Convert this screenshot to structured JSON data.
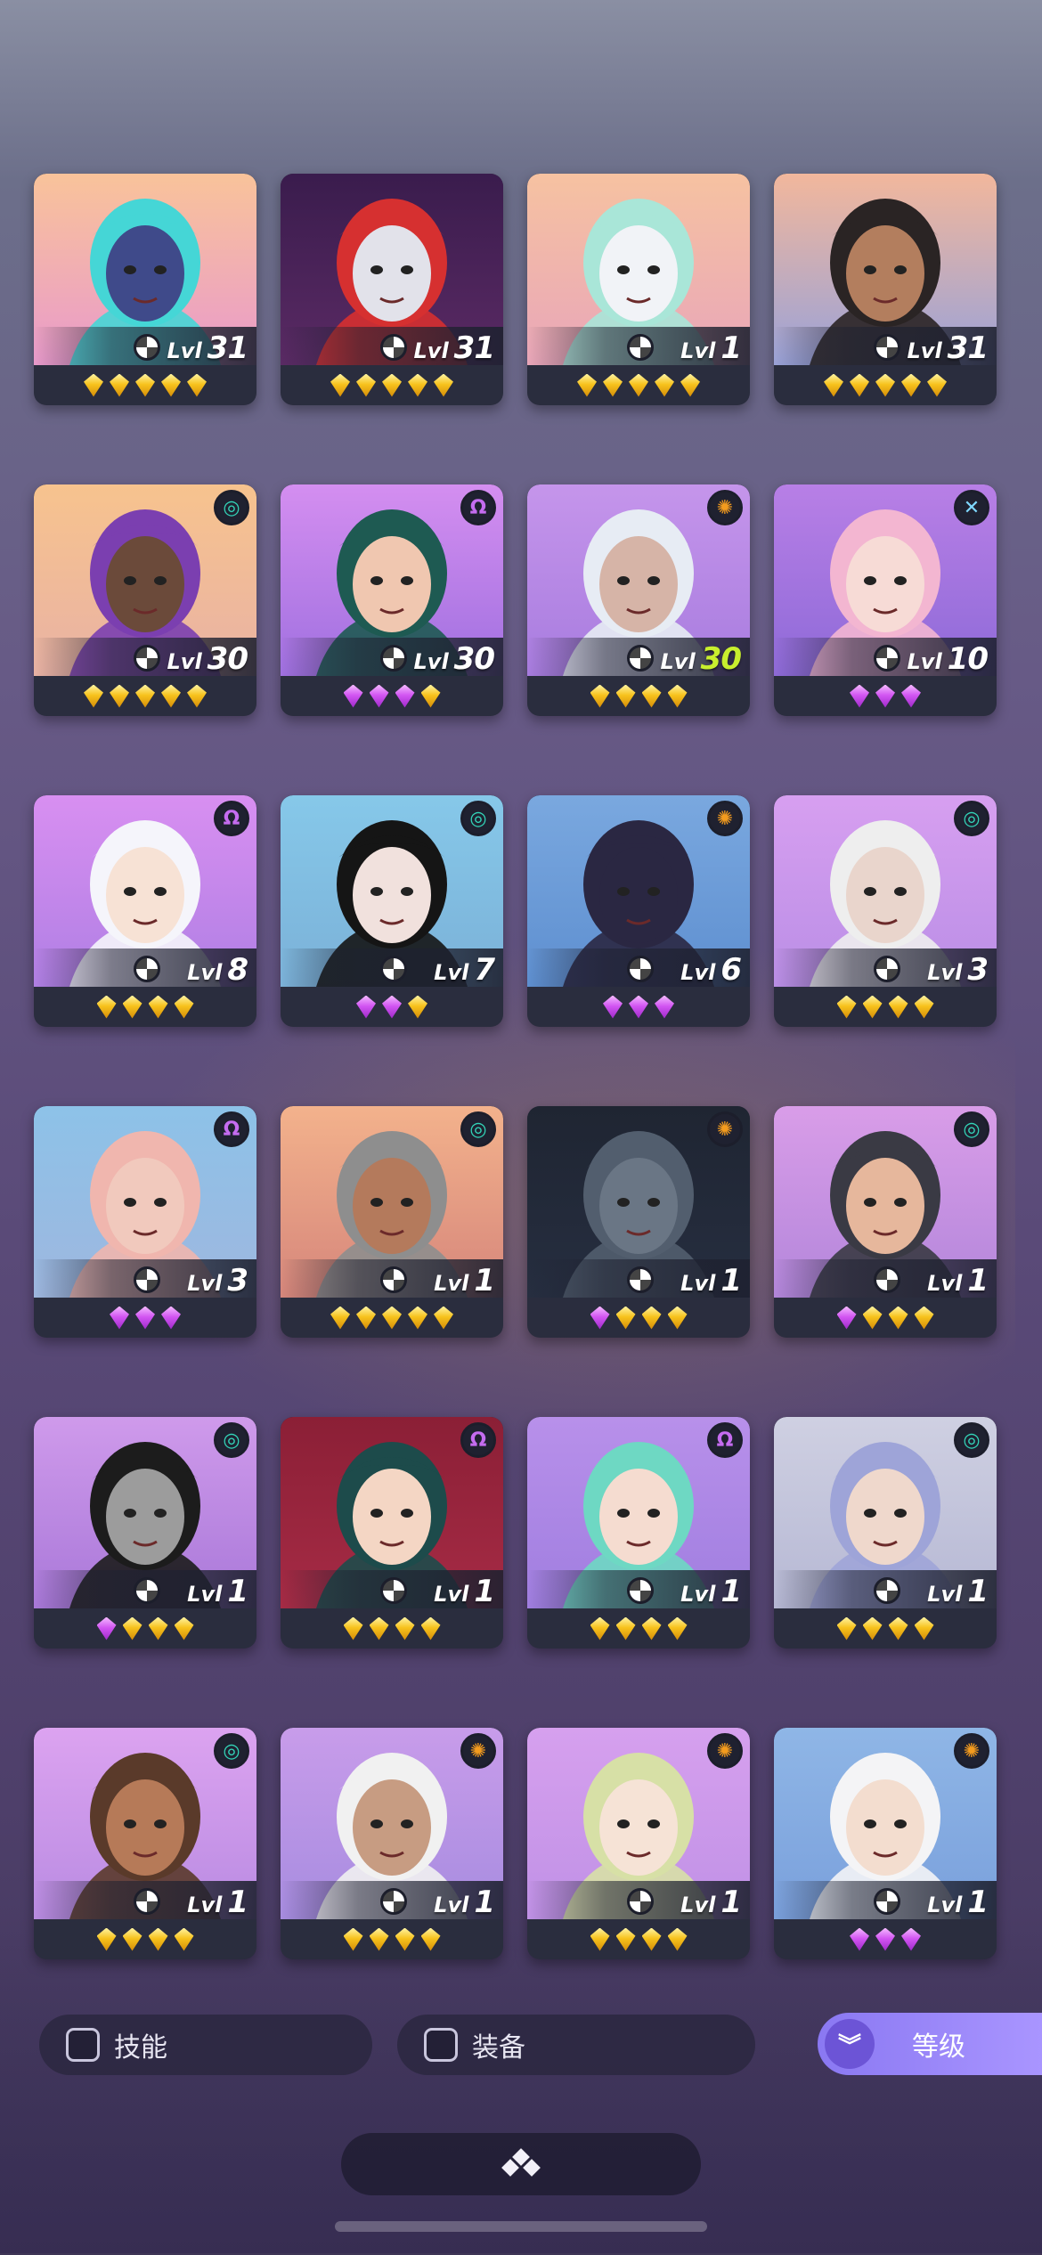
{
  "heroes": [
    {
      "level": "31",
      "stars": [
        "gold",
        "gold",
        "gold",
        "gold",
        "gold"
      ],
      "badge": null,
      "colors": [
        "#f9c39a",
        "#e99acb"
      ],
      "skin": "#3f4a8a",
      "hair": "#45d6d6"
    },
    {
      "level": "31",
      "stars": [
        "gold",
        "gold",
        "gold",
        "gold",
        "gold"
      ],
      "badge": null,
      "colors": [
        "#3a1c4d",
        "#5a2a64"
      ],
      "skin": "#e2e2ea",
      "hair": "#d63030"
    },
    {
      "level": "1",
      "stars": [
        "gold",
        "gold",
        "gold",
        "gold",
        "gold"
      ],
      "badge": null,
      "colors": [
        "#f6c2a1",
        "#e9a6b9"
      ],
      "skin": "#f1f3f7",
      "hair": "#a9e6d8"
    },
    {
      "level": "31",
      "stars": [
        "gold",
        "gold",
        "gold",
        "gold",
        "gold"
      ],
      "badge": null,
      "colors": [
        "#f2b79c",
        "#9aa2d8"
      ],
      "skin": "#b37e5e",
      "hair": "#2a2424"
    },
    {
      "level": "30",
      "stars": [
        "gold",
        "gold",
        "gold",
        "gold",
        "gold"
      ],
      "badge": "teal",
      "colors": [
        "#f7c38e",
        "#e9b2a4"
      ],
      "skin": "#6b4a3a",
      "hair": "#7b3fb0"
    },
    {
      "level": "30",
      "stars": [
        "purple",
        "purple",
        "purple",
        "gold"
      ],
      "badge": "purple",
      "colors": [
        "#d48ef0",
        "#a070e0"
      ],
      "skin": "#f0c7b0",
      "hair": "#1e5a52"
    },
    {
      "level": "30",
      "stars": [
        "gold",
        "gold",
        "gold",
        "gold"
      ],
      "badge": "orange",
      "colors": [
        "#c595eb",
        "#a87cdf"
      ],
      "skin": "#d6b4a7",
      "hair": "#e7ecf4",
      "green": true
    },
    {
      "level": "10",
      "stars": [
        "purple",
        "purple",
        "purple"
      ],
      "badge": "blue",
      "colors": [
        "#b87fe6",
        "#8e6ad8"
      ],
      "skin": "#f7dbd6",
      "hair": "#f3b6d1"
    },
    {
      "level": "8",
      "stars": [
        "gold",
        "gold",
        "gold",
        "gold"
      ],
      "badge": "purple",
      "colors": [
        "#d88ff1",
        "#b07fe4"
      ],
      "skin": "#f7e2d5",
      "hair": "#f5f5fb"
    },
    {
      "level": "7",
      "stars": [
        "purple",
        "purple",
        "gold"
      ],
      "badge": "teal",
      "colors": [
        "#86c8e9",
        "#7bb1d8"
      ],
      "skin": "#f1e1dd",
      "hair": "#151515"
    },
    {
      "level": "6",
      "stars": [
        "purple",
        "purple",
        "purple"
      ],
      "badge": "orange",
      "colors": [
        "#7aa8df",
        "#5e8fd0"
      ],
      "skin": "#2a2742",
      "hair": "#2a2742"
    },
    {
      "level": "3",
      "stars": [
        "gold",
        "gold",
        "gold",
        "gold"
      ],
      "badge": "teal",
      "colors": [
        "#d79ff0",
        "#ba8ee6"
      ],
      "skin": "#e9d5cc",
      "hair": "#eee"
    },
    {
      "level": "3",
      "stars": [
        "purple",
        "purple",
        "purple"
      ],
      "badge": "purple",
      "colors": [
        "#8dc2e8",
        "#9eb7df"
      ],
      "skin": "#f1c9bd",
      "hair": "#f0b6ae"
    },
    {
      "level": "1",
      "stars": [
        "gold",
        "gold",
        "gold",
        "gold",
        "gold"
      ],
      "badge": "teal",
      "colors": [
        "#f3b28c",
        "#d6867b"
      ],
      "skin": "#b47a5c",
      "hair": "#8e8e8e"
    },
    {
      "level": "1",
      "stars": [
        "purple",
        "gold",
        "gold",
        "gold"
      ],
      "badge": "orange",
      "colors": [
        "#1f2532",
        "#262e40"
      ],
      "skin": "#6a7685",
      "hair": "#525e6e"
    },
    {
      "level": "1",
      "stars": [
        "purple",
        "gold",
        "gold",
        "gold"
      ],
      "badge": "teal",
      "colors": [
        "#d99de8",
        "#b386db"
      ],
      "skin": "#e6b79c",
      "hair": "#3a3a44"
    },
    {
      "level": "1",
      "stars": [
        "purple",
        "gold",
        "gold",
        "gold"
      ],
      "badge": "teal",
      "colors": [
        "#cf9aeb",
        "#a978d9"
      ],
      "skin": "#9c9c9c",
      "hair": "#1c1c1c"
    },
    {
      "level": "1",
      "stars": [
        "gold",
        "gold",
        "gold",
        "gold"
      ],
      "badge": "purple",
      "colors": [
        "#8b1f36",
        "#a62b45"
      ],
      "skin": "#f4d6c4",
      "hair": "#1d4b4b"
    },
    {
      "level": "1",
      "stars": [
        "gold",
        "gold",
        "gold",
        "gold"
      ],
      "badge": "purple",
      "colors": [
        "#b890ea",
        "#a07ee0"
      ],
      "skin": "#f5dcd0",
      "hair": "#6ed8c3"
    },
    {
      "level": "1",
      "stars": [
        "gold",
        "gold",
        "gold",
        "gold"
      ],
      "badge": "teal",
      "colors": [
        "#cfd0e2",
        "#b6b8d4"
      ],
      "skin": "#efd8cc",
      "hair": "#9ea4d8"
    },
    {
      "level": "1",
      "stars": [
        "gold",
        "gold",
        "gold",
        "gold"
      ],
      "badge": "teal",
      "colors": [
        "#dca3f0",
        "#b98be2"
      ],
      "skin": "#b67a58",
      "hair": "#5a3a2a"
    },
    {
      "level": "1",
      "stars": [
        "gold",
        "gold",
        "gold",
        "gold"
      ],
      "badge": "orange",
      "colors": [
        "#c89cea",
        "#a78ce0"
      ],
      "skin": "#c79c82",
      "hair": "#f1f1f1"
    },
    {
      "level": "1",
      "stars": [
        "gold",
        "gold",
        "gold",
        "gold"
      ],
      "badge": "orange",
      "colors": [
        "#d6a0ee",
        "#c091e6"
      ],
      "skin": "#f6e3d6",
      "hair": "#d7e0a6"
    },
    {
      "level": "1",
      "stars": [
        "purple",
        "purple",
        "purple"
      ],
      "badge": "orange",
      "colors": [
        "#8fb6e6",
        "#7aa0dc"
      ],
      "skin": "#f3ddcf",
      "hair": "#f4f4f6"
    }
  ],
  "level_prefix": "Lvl",
  "filters": {
    "skills": "技能",
    "equipment": "装备"
  },
  "sort": {
    "label": "等级",
    "icon": "double-chevron-down-icon"
  },
  "badge_icons": {
    "teal": "swirl-icon",
    "purple": "omega-icon",
    "orange": "gear-icon",
    "blue": "cross-icon"
  }
}
